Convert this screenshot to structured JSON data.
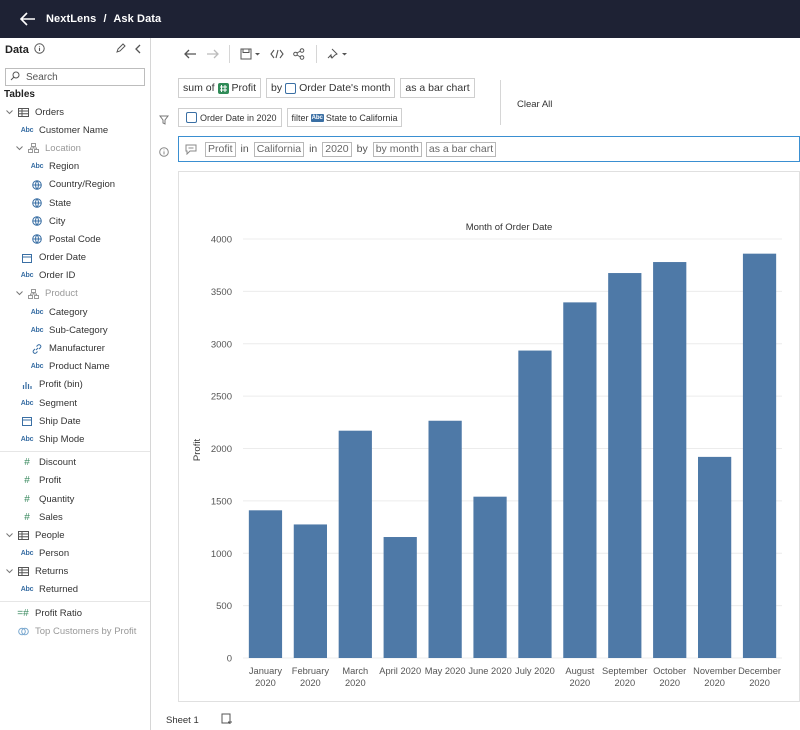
{
  "header": {
    "app_name": "NextLens",
    "separator": "/",
    "page": "Ask Data"
  },
  "sidebar": {
    "title": "Data",
    "search_placeholder": "Search",
    "tables_label": "Tables",
    "items": [
      {
        "label": "Orders",
        "type": "table",
        "indent": 0,
        "caret": "v"
      },
      {
        "label": "Customer Name",
        "type": "abc",
        "indent": 1
      },
      {
        "label": "Location",
        "type": "hierarchy",
        "indent": 1,
        "caret": "v",
        "gray": true
      },
      {
        "label": "Region",
        "type": "abc",
        "indent": 2
      },
      {
        "label": "Country/Region",
        "type": "globe",
        "indent": 2
      },
      {
        "label": "State",
        "type": "globe",
        "indent": 2
      },
      {
        "label": "City",
        "type": "globe",
        "indent": 2
      },
      {
        "label": "Postal Code",
        "type": "globe",
        "indent": 2
      },
      {
        "label": "Order Date",
        "type": "date",
        "indent": 1
      },
      {
        "label": "Order ID",
        "type": "abc",
        "indent": 1
      },
      {
        "label": "Product",
        "type": "hierarchy",
        "indent": 1,
        "caret": "v",
        "gray": true
      },
      {
        "label": "Category",
        "type": "abc",
        "indent": 2
      },
      {
        "label": "Sub-Category",
        "type": "abc",
        "indent": 2
      },
      {
        "label": "Manufacturer",
        "type": "link",
        "indent": 2
      },
      {
        "label": "Product Name",
        "type": "abc",
        "indent": 2
      },
      {
        "label": "Profit (bin)",
        "type": "bin",
        "indent": 1
      },
      {
        "label": "Segment",
        "type": "abc",
        "indent": 1
      },
      {
        "label": "Ship Date",
        "type": "date",
        "indent": 1
      },
      {
        "label": "Ship Mode",
        "type": "abc",
        "indent": 1
      },
      {
        "label": "",
        "type": "separator"
      },
      {
        "label": "Discount",
        "type": "hash",
        "indent": 1
      },
      {
        "label": "Profit",
        "type": "hash",
        "indent": 1
      },
      {
        "label": "Quantity",
        "type": "hash",
        "indent": 1
      },
      {
        "label": "Sales",
        "type": "hash",
        "indent": 1
      },
      {
        "label": "People",
        "type": "table",
        "indent": 0,
        "caret": "v"
      },
      {
        "label": "Person",
        "type": "abc",
        "indent": 1
      },
      {
        "label": "Returns",
        "type": "table",
        "indent": 0,
        "caret": "v"
      },
      {
        "label": "Returned",
        "type": "abc",
        "indent": 1
      },
      {
        "label": "",
        "type": "separator"
      },
      {
        "label": "Profit Ratio",
        "type": "calc",
        "indent": 0
      },
      {
        "label": "Top Customers by Profit",
        "type": "set",
        "indent": 0,
        "gray": true
      }
    ]
  },
  "pills": {
    "row1": {
      "sum_of": "sum of",
      "profit": "Profit",
      "by": "by",
      "order_date_month": "Order Date's month",
      "as_bar_chart": "as a bar chart"
    },
    "row2": {
      "order_date_2020": "Order Date in 2020",
      "filter": "filter",
      "state_california": "State to California"
    },
    "clear_all": "Clear All"
  },
  "query": {
    "t1": "Profit",
    "w1": "in",
    "t2": "California",
    "w2": "in",
    "t3": "2020",
    "w3": "by",
    "t4": "by month",
    "t5": "as a bar chart"
  },
  "sheet": {
    "tab": "Sheet 1"
  },
  "colors": {
    "bar": "#4e79a7",
    "header_bg": "#1e2234"
  },
  "chart_data": {
    "type": "bar",
    "title": "Month of Order Date",
    "xlabel": "",
    "ylabel": "Profit",
    "ylim": [
      0,
      4000
    ],
    "yticks": [
      0,
      500,
      1000,
      1500,
      2000,
      2500,
      3000,
      3500,
      4000
    ],
    "categories": [
      [
        "January",
        "2020"
      ],
      [
        "February",
        "2020"
      ],
      [
        "March",
        "2020"
      ],
      [
        "April 2020"
      ],
      [
        "May 2020"
      ],
      [
        "June 2020"
      ],
      [
        "July 2020"
      ],
      [
        "August",
        "2020"
      ],
      [
        "September",
        "2020"
      ],
      [
        "October",
        "2020"
      ],
      [
        "November",
        "2020"
      ],
      [
        "December",
        "2020"
      ]
    ],
    "values": [
      1410,
      1275,
      2170,
      1155,
      2265,
      1540,
      2935,
      3395,
      3675,
      3780,
      1920,
      3860
    ]
  }
}
